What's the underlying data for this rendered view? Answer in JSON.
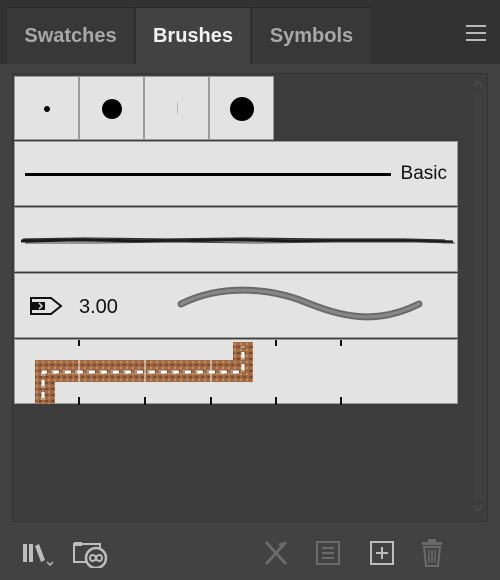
{
  "tabs": [
    {
      "label": "Swatches",
      "active": false
    },
    {
      "label": "Brushes",
      "active": true
    },
    {
      "label": "Symbols",
      "active": false
    }
  ],
  "menu_icon": "hamburger-menu-icon",
  "calligraphic_brushes": [
    {
      "name": "small-round-dab"
    },
    {
      "name": "medium-round-dab"
    },
    {
      "name": "tiny-dash-dab"
    },
    {
      "name": "large-round-dab"
    }
  ],
  "brushes": {
    "basic": {
      "label": "Basic"
    },
    "charcoal": {
      "name": "charcoal-art-brush"
    },
    "width_profile": {
      "value": "3.00",
      "icon": "width-profile-tag-icon"
    },
    "pattern": {
      "name": "border-pattern-brush"
    }
  },
  "bottom_toolbar": {
    "icons": [
      "brush-libraries-icon",
      "libraries-panel-icon",
      "remove-brush-stroke-icon",
      "options-of-selected-object-icon",
      "new-brush-icon",
      "delete-brush-icon"
    ]
  },
  "colors": {
    "panel_bg": "#424242",
    "tabbar_bg": "#323232",
    "swatch_bg": "#e3e3e3",
    "active_tab_text": "#f2f2f2",
    "inactive_tab_text": "#a8a8a8"
  }
}
